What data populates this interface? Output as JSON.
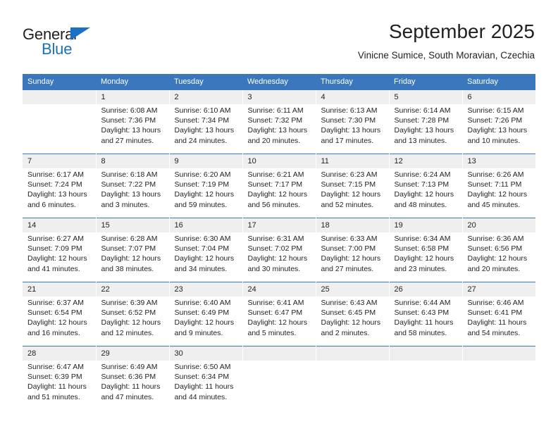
{
  "brand": {
    "name_top": "General",
    "name_bottom": "Blue",
    "triangle_icon": "triangle-icon",
    "color_blue": "#1a70c4",
    "color_dark": "#231f20"
  },
  "header": {
    "title": "September 2025",
    "subtitle": "Vinicne Sumice, South Moravian, Czechia"
  },
  "theme": {
    "header_bg": "#3b77bc",
    "daynum_bg": "#efefef",
    "cell_bg": "#ffffff",
    "text": "#231f20"
  },
  "calendar": {
    "weekday_headers": [
      "Sunday",
      "Monday",
      "Tuesday",
      "Wednesday",
      "Thursday",
      "Friday",
      "Saturday"
    ],
    "weeks": [
      [
        {
          "day": "",
          "lines": []
        },
        {
          "day": "1",
          "lines": [
            "Sunrise: 6:08 AM",
            "Sunset: 7:36 PM",
            "Daylight: 13 hours",
            "and 27 minutes."
          ]
        },
        {
          "day": "2",
          "lines": [
            "Sunrise: 6:10 AM",
            "Sunset: 7:34 PM",
            "Daylight: 13 hours",
            "and 24 minutes."
          ]
        },
        {
          "day": "3",
          "lines": [
            "Sunrise: 6:11 AM",
            "Sunset: 7:32 PM",
            "Daylight: 13 hours",
            "and 20 minutes."
          ]
        },
        {
          "day": "4",
          "lines": [
            "Sunrise: 6:13 AM",
            "Sunset: 7:30 PM",
            "Daylight: 13 hours",
            "and 17 minutes."
          ]
        },
        {
          "day": "5",
          "lines": [
            "Sunrise: 6:14 AM",
            "Sunset: 7:28 PM",
            "Daylight: 13 hours",
            "and 13 minutes."
          ]
        },
        {
          "day": "6",
          "lines": [
            "Sunrise: 6:15 AM",
            "Sunset: 7:26 PM",
            "Daylight: 13 hours",
            "and 10 minutes."
          ]
        }
      ],
      [
        {
          "day": "7",
          "lines": [
            "Sunrise: 6:17 AM",
            "Sunset: 7:24 PM",
            "Daylight: 13 hours",
            "and 6 minutes."
          ]
        },
        {
          "day": "8",
          "lines": [
            "Sunrise: 6:18 AM",
            "Sunset: 7:22 PM",
            "Daylight: 13 hours",
            "and 3 minutes."
          ]
        },
        {
          "day": "9",
          "lines": [
            "Sunrise: 6:20 AM",
            "Sunset: 7:19 PM",
            "Daylight: 12 hours",
            "and 59 minutes."
          ]
        },
        {
          "day": "10",
          "lines": [
            "Sunrise: 6:21 AM",
            "Sunset: 7:17 PM",
            "Daylight: 12 hours",
            "and 56 minutes."
          ]
        },
        {
          "day": "11",
          "lines": [
            "Sunrise: 6:23 AM",
            "Sunset: 7:15 PM",
            "Daylight: 12 hours",
            "and 52 minutes."
          ]
        },
        {
          "day": "12",
          "lines": [
            "Sunrise: 6:24 AM",
            "Sunset: 7:13 PM",
            "Daylight: 12 hours",
            "and 48 minutes."
          ]
        },
        {
          "day": "13",
          "lines": [
            "Sunrise: 6:26 AM",
            "Sunset: 7:11 PM",
            "Daylight: 12 hours",
            "and 45 minutes."
          ]
        }
      ],
      [
        {
          "day": "14",
          "lines": [
            "Sunrise: 6:27 AM",
            "Sunset: 7:09 PM",
            "Daylight: 12 hours",
            "and 41 minutes."
          ]
        },
        {
          "day": "15",
          "lines": [
            "Sunrise: 6:28 AM",
            "Sunset: 7:07 PM",
            "Daylight: 12 hours",
            "and 38 minutes."
          ]
        },
        {
          "day": "16",
          "lines": [
            "Sunrise: 6:30 AM",
            "Sunset: 7:04 PM",
            "Daylight: 12 hours",
            "and 34 minutes."
          ]
        },
        {
          "day": "17",
          "lines": [
            "Sunrise: 6:31 AM",
            "Sunset: 7:02 PM",
            "Daylight: 12 hours",
            "and 30 minutes."
          ]
        },
        {
          "day": "18",
          "lines": [
            "Sunrise: 6:33 AM",
            "Sunset: 7:00 PM",
            "Daylight: 12 hours",
            "and 27 minutes."
          ]
        },
        {
          "day": "19",
          "lines": [
            "Sunrise: 6:34 AM",
            "Sunset: 6:58 PM",
            "Daylight: 12 hours",
            "and 23 minutes."
          ]
        },
        {
          "day": "20",
          "lines": [
            "Sunrise: 6:36 AM",
            "Sunset: 6:56 PM",
            "Daylight: 12 hours",
            "and 20 minutes."
          ]
        }
      ],
      [
        {
          "day": "21",
          "lines": [
            "Sunrise: 6:37 AM",
            "Sunset: 6:54 PM",
            "Daylight: 12 hours",
            "and 16 minutes."
          ]
        },
        {
          "day": "22",
          "lines": [
            "Sunrise: 6:39 AM",
            "Sunset: 6:52 PM",
            "Daylight: 12 hours",
            "and 12 minutes."
          ]
        },
        {
          "day": "23",
          "lines": [
            "Sunrise: 6:40 AM",
            "Sunset: 6:49 PM",
            "Daylight: 12 hours",
            "and 9 minutes."
          ]
        },
        {
          "day": "24",
          "lines": [
            "Sunrise: 6:41 AM",
            "Sunset: 6:47 PM",
            "Daylight: 12 hours",
            "and 5 minutes."
          ]
        },
        {
          "day": "25",
          "lines": [
            "Sunrise: 6:43 AM",
            "Sunset: 6:45 PM",
            "Daylight: 12 hours",
            "and 2 minutes."
          ]
        },
        {
          "day": "26",
          "lines": [
            "Sunrise: 6:44 AM",
            "Sunset: 6:43 PM",
            "Daylight: 11 hours",
            "and 58 minutes."
          ]
        },
        {
          "day": "27",
          "lines": [
            "Sunrise: 6:46 AM",
            "Sunset: 6:41 PM",
            "Daylight: 11 hours",
            "and 54 minutes."
          ]
        }
      ],
      [
        {
          "day": "28",
          "lines": [
            "Sunrise: 6:47 AM",
            "Sunset: 6:39 PM",
            "Daylight: 11 hours",
            "and 51 minutes."
          ]
        },
        {
          "day": "29",
          "lines": [
            "Sunrise: 6:49 AM",
            "Sunset: 6:36 PM",
            "Daylight: 11 hours",
            "and 47 minutes."
          ]
        },
        {
          "day": "30",
          "lines": [
            "Sunrise: 6:50 AM",
            "Sunset: 6:34 PM",
            "Daylight: 11 hours",
            "and 44 minutes."
          ]
        },
        {
          "day": "",
          "lines": []
        },
        {
          "day": "",
          "lines": []
        },
        {
          "day": "",
          "lines": []
        },
        {
          "day": "",
          "lines": []
        }
      ]
    ]
  }
}
